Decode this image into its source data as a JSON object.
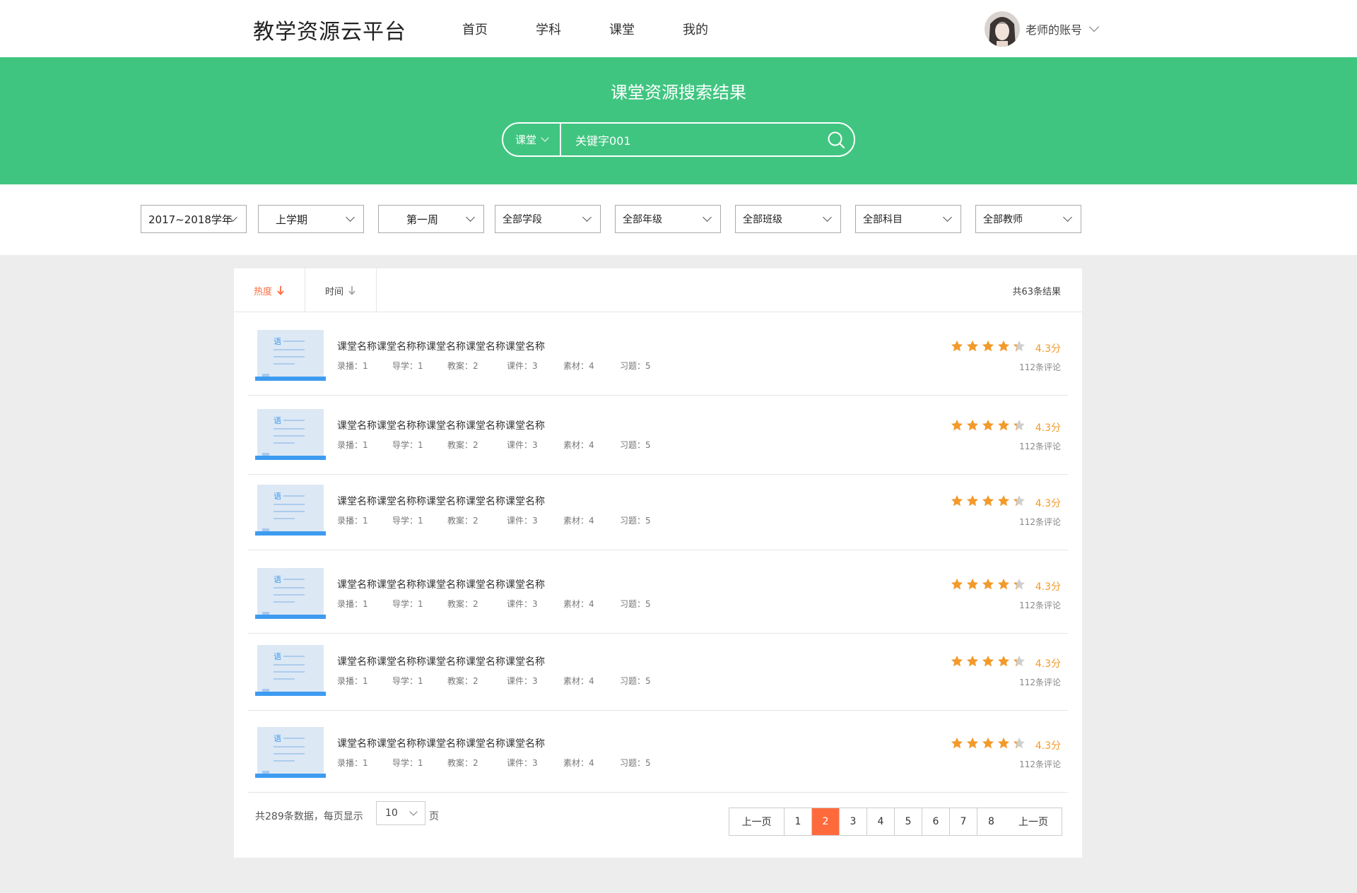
{
  "header": {
    "logo": "教学资源云平台",
    "nav": [
      "首页",
      "学科",
      "课堂",
      "我的"
    ],
    "account": "老师的账号"
  },
  "banner": {
    "title": "课堂资源搜索结果",
    "scope": "课堂",
    "keyword": "关键字001"
  },
  "filters": [
    "2017~2018学年",
    "上学期",
    "第一周",
    "全部学段",
    "全部年级",
    "全部班级",
    "全部科目",
    "全部教师"
  ],
  "sort": {
    "tabs": [
      "热度",
      "时间"
    ],
    "active": 0,
    "result_count": "共63条结果"
  },
  "results": [
    {
      "thumb_char": "语",
      "title": "课堂名称课堂名称称课堂名称课堂名称课堂名称",
      "stats": [
        "录播：1",
        "导学：1",
        "教案：2",
        "课件：3",
        "素材：4",
        "习题：5"
      ],
      "rating": 4.3,
      "score": "4.3分",
      "reviews": "112条评论"
    },
    {
      "thumb_char": "语",
      "title": "课堂名称课堂名称称课堂名称课堂名称课堂名称",
      "stats": [
        "录播：1",
        "导学：1",
        "教案：2",
        "课件：3",
        "素材：4",
        "习题：5"
      ],
      "rating": 4.3,
      "score": "4.3分",
      "reviews": "112条评论"
    },
    {
      "thumb_char": "语",
      "title": "课堂名称课堂名称称课堂名称课堂名称课堂名称",
      "stats": [
        "录播：1",
        "导学：1",
        "教案：2",
        "课件：3",
        "素材：4",
        "习题：5"
      ],
      "rating": 4.3,
      "score": "4.3分",
      "reviews": "112条评论"
    },
    {
      "thumb_char": "语",
      "title": "课堂名称课堂名称称课堂名称课堂名称课堂名称",
      "stats": [
        "录播：1",
        "导学：1",
        "教案：2",
        "课件：3",
        "素材：4",
        "习题：5"
      ],
      "rating": 4.3,
      "score": "4.3分",
      "reviews": "112条评论"
    },
    {
      "thumb_char": "语",
      "title": "课堂名称课堂名称称课堂名称课堂名称课堂名称",
      "stats": [
        "录播：1",
        "导学：1",
        "教案：2",
        "课件：3",
        "素材：4",
        "习题：5"
      ],
      "rating": 4.3,
      "score": "4.3分",
      "reviews": "112条评论"
    },
    {
      "thumb_char": "语",
      "title": "课堂名称课堂名称称课堂名称课堂名称课堂名称",
      "stats": [
        "录播：1",
        "导学：1",
        "教案：2",
        "课件：3",
        "素材：4",
        "习题：5"
      ],
      "rating": 4.3,
      "score": "4.3分",
      "reviews": "112条评论"
    }
  ],
  "footer": {
    "total_text": "共289条数据，每页显示",
    "page_size": "10",
    "page_unit": "页",
    "prev_label": "上一页",
    "next_label": "上一页",
    "pages": [
      "1",
      "2",
      "3",
      "4",
      "5",
      "6",
      "7",
      "8"
    ],
    "current_page": "2"
  },
  "colors": {
    "brand_green": "#40c580",
    "active_orange": "#ff6a3d",
    "star": "#f39a2a",
    "thumb_blue": "#3d9bf0"
  },
  "icons": {
    "search": "search-icon",
    "chevron": "chevron-down-icon",
    "sort_arrow": "arrow-down-icon",
    "star": "star-icon"
  }
}
